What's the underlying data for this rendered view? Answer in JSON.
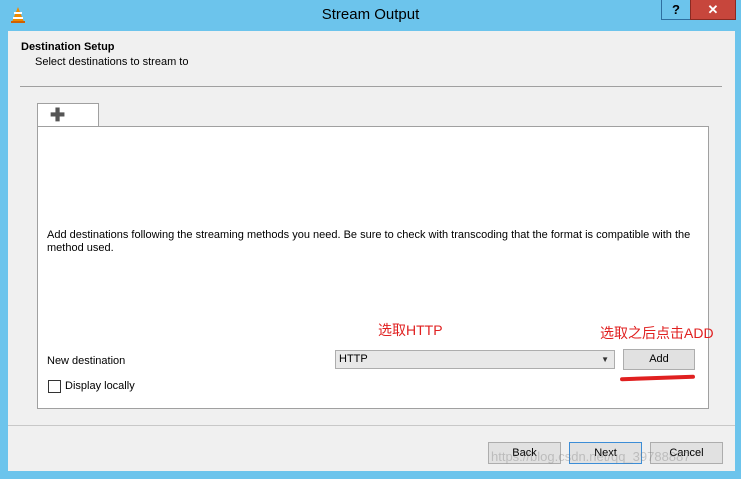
{
  "window": {
    "title": "Stream Output",
    "help_label": "?",
    "close_label": "✕"
  },
  "header": {
    "title": "Destination Setup",
    "subtitle": "Select destinations to stream to"
  },
  "tab": {
    "icon": "plus-icon"
  },
  "panel": {
    "description": "Add destinations following the streaming methods you need. Be sure to check with transcoding that the format is compatible with the method used.",
    "new_destination_label": "New destination",
    "destination_select_value": "HTTP",
    "add_label": "Add",
    "display_locally_label": "Display locally"
  },
  "annotations": {
    "choose_http": "选取HTTP",
    "then_click_add": "选取之后点击ADD"
  },
  "footer": {
    "back_label": "Back",
    "next_label": "Next",
    "cancel_label": "Cancel"
  },
  "watermark": "https://blog.csdn.net/qq_39788887",
  "colors": {
    "titlebar": "#6cc4ec",
    "close_button": "#c7463c",
    "annotation": "#e02020"
  }
}
